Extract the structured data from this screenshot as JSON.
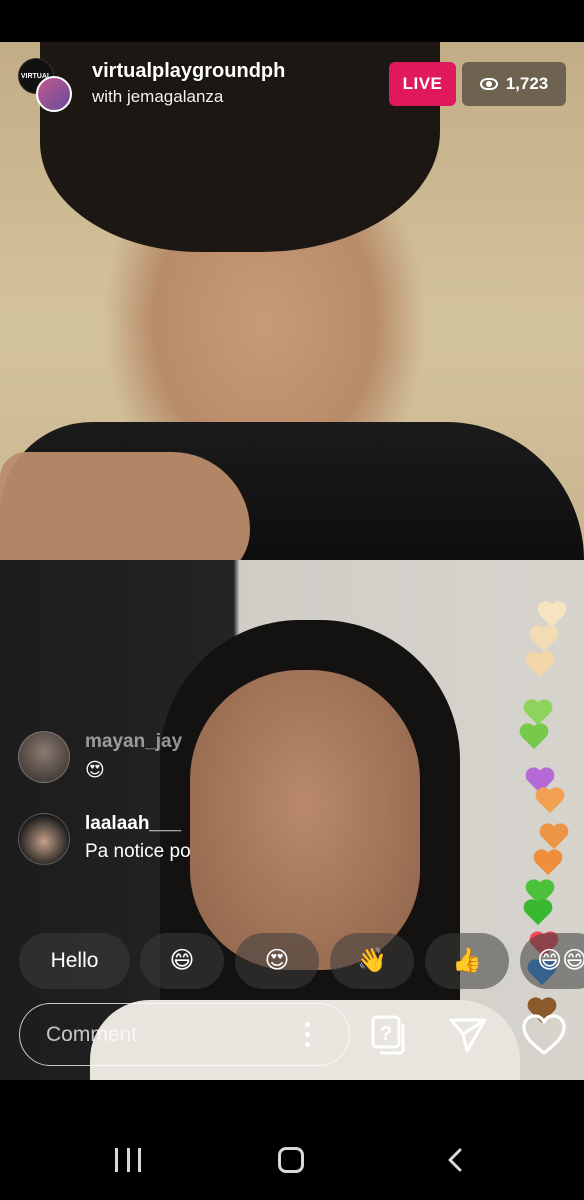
{
  "stream": {
    "host_username": "virtualplaygroundph",
    "guest_line": "with jemagalanza",
    "host_avatar_text": "VIRTUAL",
    "live_label": "LIVE",
    "viewer_count": "1,723"
  },
  "comments": [
    {
      "username": "mayan_jay",
      "text": "😍"
    },
    {
      "username": "laalaah___",
      "text": "Pa notice po"
    }
  ],
  "quick_replies": [
    "Hello",
    "😄",
    "😍",
    "👋",
    "👍",
    "😄😄"
  ],
  "comment_bar": {
    "placeholder": "Comment",
    "icons": [
      "more-options-icon",
      "question-box-icon",
      "send-icon",
      "heart-icon"
    ]
  },
  "floating_hearts": {
    "colors": [
      "#f6e4c0",
      "#f3dcb4",
      "#f2d6a8",
      "#8dd35c",
      "#76c94a",
      "#b56ad8",
      "#f0a050",
      "#ee9445",
      "#ef8f3e",
      "#4cc13c",
      "#37b82f",
      "#f04a5a",
      "#2a8ef2",
      "#8a5a2a"
    ]
  },
  "navbar": {
    "icons": [
      "recent-apps-icon",
      "home-icon",
      "back-icon"
    ]
  }
}
